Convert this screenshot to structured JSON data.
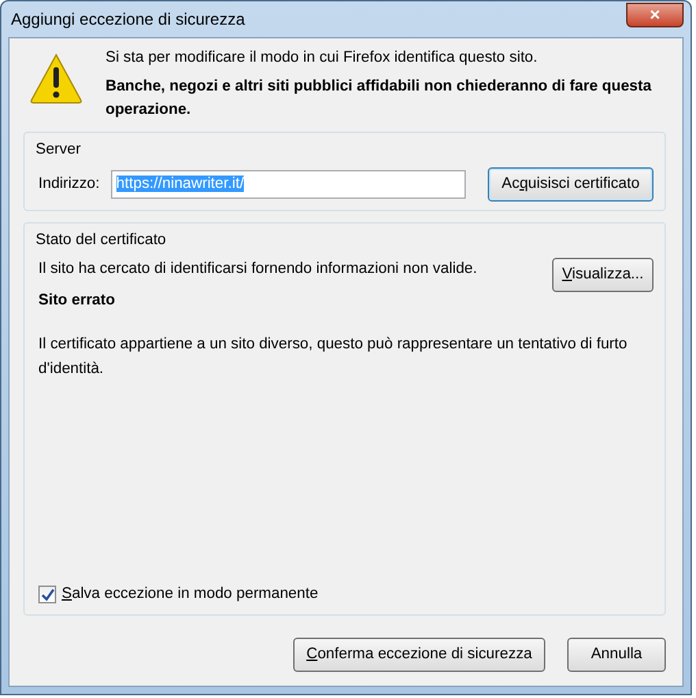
{
  "window": {
    "title": "Aggiungi eccezione di sicurezza",
    "close_button": "×"
  },
  "warning": {
    "message": "Si sta per modificare il modo in cui Firefox identifica questo sito.",
    "emphasis": "Banche, negozi e altri siti pubblici affidabili non chiederanno di fare questa operazione."
  },
  "server": {
    "legend": "Server",
    "address_label": "Indirizzo:",
    "address_value": "https://ninawriter.it/",
    "address_selected": true,
    "fetch_button": {
      "before": "Ac",
      "key": "q",
      "after": "uisisci certificato"
    }
  },
  "certificate_status": {
    "legend": "Stato del certificato",
    "summary": "Il sito ha cercato di identificarsi fornendo informazioni non valide.",
    "view_button": {
      "key": "V",
      "after": "isualizza..."
    },
    "problem_title": "Sito errato",
    "problem_text": "Il certificato appartiene a un sito diverso, questo può rappresentare un tentativo di furto d'identità.",
    "permanent": {
      "key": "S",
      "after": "alva eccezione in modo permanente",
      "checked": true
    }
  },
  "buttons": [
    {
      "key": "C",
      "after": "onferma eccezione di sicurezza"
    },
    {
      "after": "Annulla"
    }
  ]
}
